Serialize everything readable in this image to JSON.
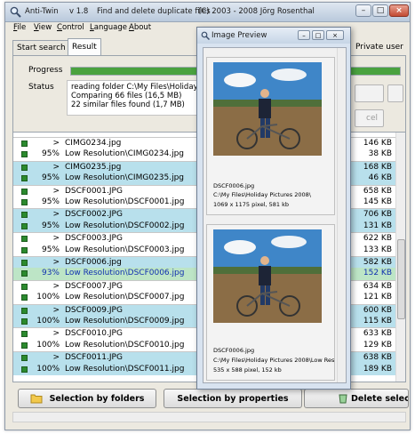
{
  "title": {
    "app_name": "Anti-Twin",
    "version": "v 1.8",
    "tagline": "Find and delete duplicate files",
    "copyright": "(C) 2003 - 2008  Jörg Rosenthal"
  },
  "window_controls": {
    "minimize": "–",
    "maximize": "□",
    "close": "×"
  },
  "menu": [
    "File",
    "View",
    "Control",
    "Language",
    "About"
  ],
  "tabs": [
    "Start search",
    "Result",
    "Private user"
  ],
  "progress": {
    "label": "Progress",
    "value_percent": 100
  },
  "status": {
    "label": "Status",
    "lines": [
      "reading folder C:\\My Files\\Holiday P",
      "Comparing 66 files (16,5 MB)",
      "22 similar files found (1,7 MB)"
    ]
  },
  "hidden_buttons": {
    "cancel_fragment": "cel"
  },
  "rows": [
    {
      "pct": ">",
      "name": "CIMG0234.jpg",
      "size": "146 KB",
      "style": "group"
    },
    {
      "pct": "95%",
      "name": "Low Resolution\\CIMG0234.jpg",
      "size": "38 KB",
      "style": "plain"
    },
    {
      "pct": ">",
      "name": "CIMG0235.jpg",
      "size": "168 KB",
      "style": "group-hl"
    },
    {
      "pct": "95%",
      "name": "Low Resolution\\CIMG0235.jpg",
      "size": "46 KB",
      "style": "hl"
    },
    {
      "pct": ">",
      "name": "DSCF0001.JPG",
      "size": "658 KB",
      "style": "group"
    },
    {
      "pct": "95%",
      "name": "Low Resolution\\DSCF0001.jpg",
      "size": "145 KB",
      "style": "plain"
    },
    {
      "pct": ">",
      "name": "DSCF0002.JPG",
      "size": "706 KB",
      "style": "group-hl"
    },
    {
      "pct": "95%",
      "name": "Low Resolution\\DSCF0002.jpg",
      "size": "131 KB",
      "style": "hl"
    },
    {
      "pct": ">",
      "name": "DSCF0003.JPG",
      "size": "622 KB",
      "style": "group"
    },
    {
      "pct": "95%",
      "name": "Low Resolution\\DSCF0003.jpg",
      "size": "133 KB",
      "style": "plain"
    },
    {
      "pct": ">",
      "name": "DSCF0006.jpg",
      "size": "582 KB",
      "style": "group-hl"
    },
    {
      "pct": "93%",
      "name": "Low Resolution\\DSCF0006.jpg",
      "size": "152 KB",
      "style": "sel"
    },
    {
      "pct": ">",
      "name": "DSCF0007.JPG",
      "size": "634 KB",
      "style": "group"
    },
    {
      "pct": "100%",
      "name": "Low Resolution\\DSCF0007.jpg",
      "size": "121 KB",
      "style": "plain"
    },
    {
      "pct": ">",
      "name": "DSCF0009.JPG",
      "size": "600 KB",
      "style": "group-hl"
    },
    {
      "pct": "100%",
      "name": "Low Resolution\\DSCF0009.jpg",
      "size": "115 KB",
      "style": "hl"
    },
    {
      "pct": ">",
      "name": "DSCF0010.JPG",
      "size": "633 KB",
      "style": "group"
    },
    {
      "pct": "100%",
      "name": "Low Resolution\\DSCF0010.jpg",
      "size": "129 KB",
      "style": "plain"
    },
    {
      "pct": ">",
      "name": "DSCF0011.JPG",
      "size": "638 KB",
      "style": "group-hl"
    },
    {
      "pct": "100%",
      "name": "Low Resolution\\DSCF0011.jpg",
      "size": "189 KB",
      "style": "hl"
    }
  ],
  "bottom_buttons": {
    "by_folders": "Selection by folders",
    "by_properties": "Selection by properties",
    "delete": "Delete selec"
  },
  "preview": {
    "title": "Image Preview",
    "images": [
      {
        "filename": "DSCF0006.jpg",
        "path": "C:\\My Files\\Holiday Pictures 2008\\",
        "info": "1069 x 1175 pixel, 581 kb"
      },
      {
        "filename": "DSCF0006.jpg",
        "path": "C:\\My Files\\Holiday Pictures 2008\\Low Res",
        "info": "535 x 588 pixel, 152 kb"
      }
    ]
  },
  "colors": {
    "row_highlight": "#b8e0ec",
    "row_selected": "#bde5c6",
    "checkbox": "#2b8a2e",
    "progress": "#4aa23f"
  }
}
